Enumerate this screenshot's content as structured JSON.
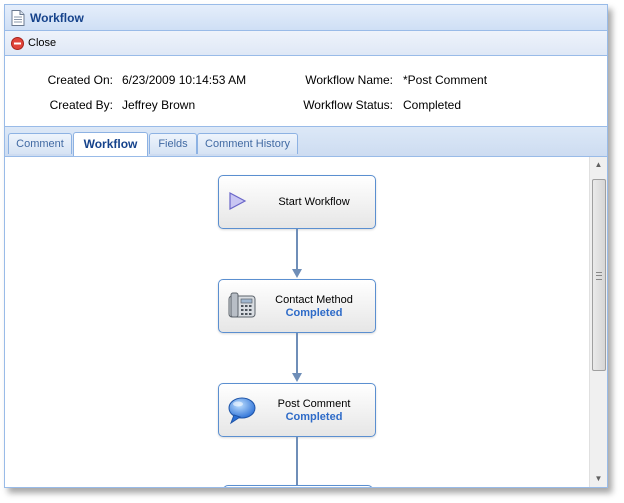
{
  "window": {
    "title": "Workflow"
  },
  "toolbar": {
    "close_label": "Close"
  },
  "info": {
    "created_on_label": "Created On:",
    "created_on_value": "6/23/2009 10:14:53 AM",
    "created_by_label": "Created By:",
    "created_by_value": "Jeffrey Brown",
    "workflow_name_label": "Workflow Name:",
    "workflow_name_value": "*Post Comment",
    "workflow_status_label": "Workflow Status:",
    "workflow_status_value": "Completed"
  },
  "tabs": [
    {
      "label": "Comment",
      "active": false
    },
    {
      "label": "Workflow",
      "active": true
    },
    {
      "label": "Fields",
      "active": false
    },
    {
      "label": "Comment History",
      "active": false
    }
  ],
  "workflow": {
    "nodes": [
      {
        "label": "Start Workflow",
        "status": "",
        "icon": "play-icon"
      },
      {
        "label": "Contact Method",
        "status": "Completed",
        "icon": "telephone-icon"
      },
      {
        "label": "Post Comment",
        "status": "Completed",
        "icon": "speech-bubble-icon"
      }
    ]
  },
  "colors": {
    "accent": "#15428b",
    "status": "#2e6bc8",
    "border": "#99bbe8",
    "connector": "#6f8eb8"
  }
}
